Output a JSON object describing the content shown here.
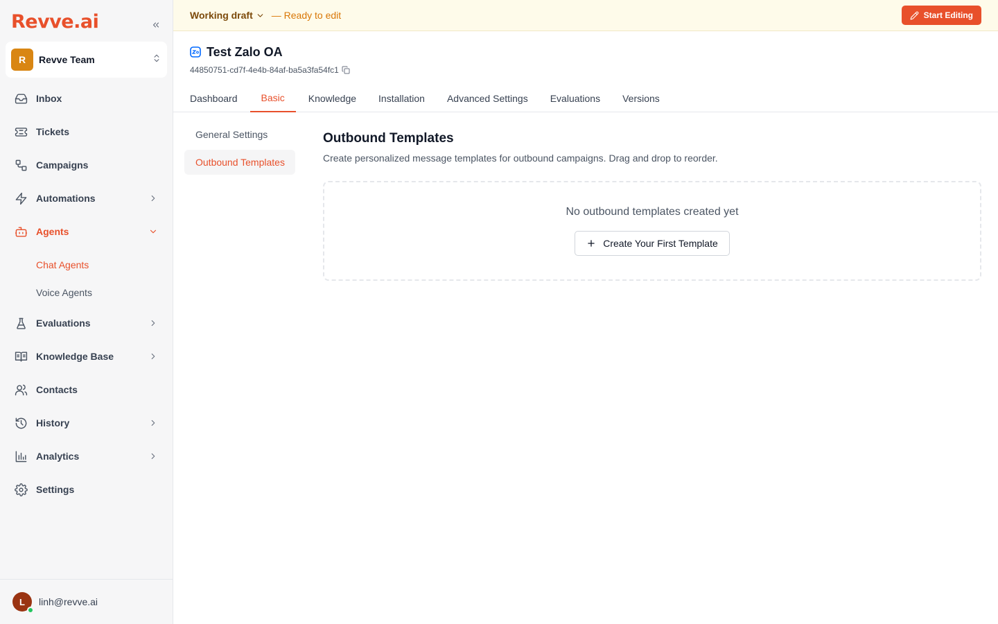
{
  "brand": {
    "logo_text": "Revve.ai",
    "accent": "#e8502b"
  },
  "team": {
    "avatar_letter": "R",
    "name": "Revve Team"
  },
  "sidebar": {
    "items": [
      {
        "label": "Inbox",
        "icon": "inbox-icon"
      },
      {
        "label": "Tickets",
        "icon": "ticket-icon"
      },
      {
        "label": "Campaigns",
        "icon": "campaigns-icon"
      },
      {
        "label": "Automations",
        "icon": "lightning-icon",
        "expandable": true
      },
      {
        "label": "Agents",
        "icon": "bot-icon",
        "expandable": true,
        "expanded": true,
        "active": true
      },
      {
        "label": "Evaluations",
        "icon": "flask-icon",
        "expandable": true
      },
      {
        "label": "Knowledge Base",
        "icon": "book-icon",
        "expandable": true
      },
      {
        "label": "Contacts",
        "icon": "users-icon"
      },
      {
        "label": "History",
        "icon": "history-icon",
        "expandable": true
      },
      {
        "label": "Analytics",
        "icon": "chart-icon",
        "expandable": true
      },
      {
        "label": "Settings",
        "icon": "gear-icon"
      }
    ],
    "agents_sub": [
      {
        "label": "Chat Agents",
        "active": true
      },
      {
        "label": "Voice Agents"
      }
    ]
  },
  "user": {
    "avatar_letter": "L",
    "email": "linh@revve.ai",
    "online": true
  },
  "draft_bar": {
    "draft_label": "Working draft",
    "status": "— Ready to edit",
    "start_editing": "Start Editing"
  },
  "agent": {
    "name": "Test Zalo OA",
    "id": "44850751-cd7f-4e4b-84af-ba5a3fa54fc1",
    "channel_icon": "zalo-icon"
  },
  "tabs": [
    "Dashboard",
    "Basic",
    "Knowledge",
    "Installation",
    "Advanced Settings",
    "Evaluations",
    "Versions"
  ],
  "active_tab": "Basic",
  "subnav": [
    "General Settings",
    "Outbound Templates"
  ],
  "active_subnav": "Outbound Templates",
  "main": {
    "title": "Outbound Templates",
    "description": "Create personalized message templates for outbound campaigns. Drag and drop to reorder.",
    "empty_text": "No outbound templates created yet",
    "create_button": "Create Your First Template"
  }
}
